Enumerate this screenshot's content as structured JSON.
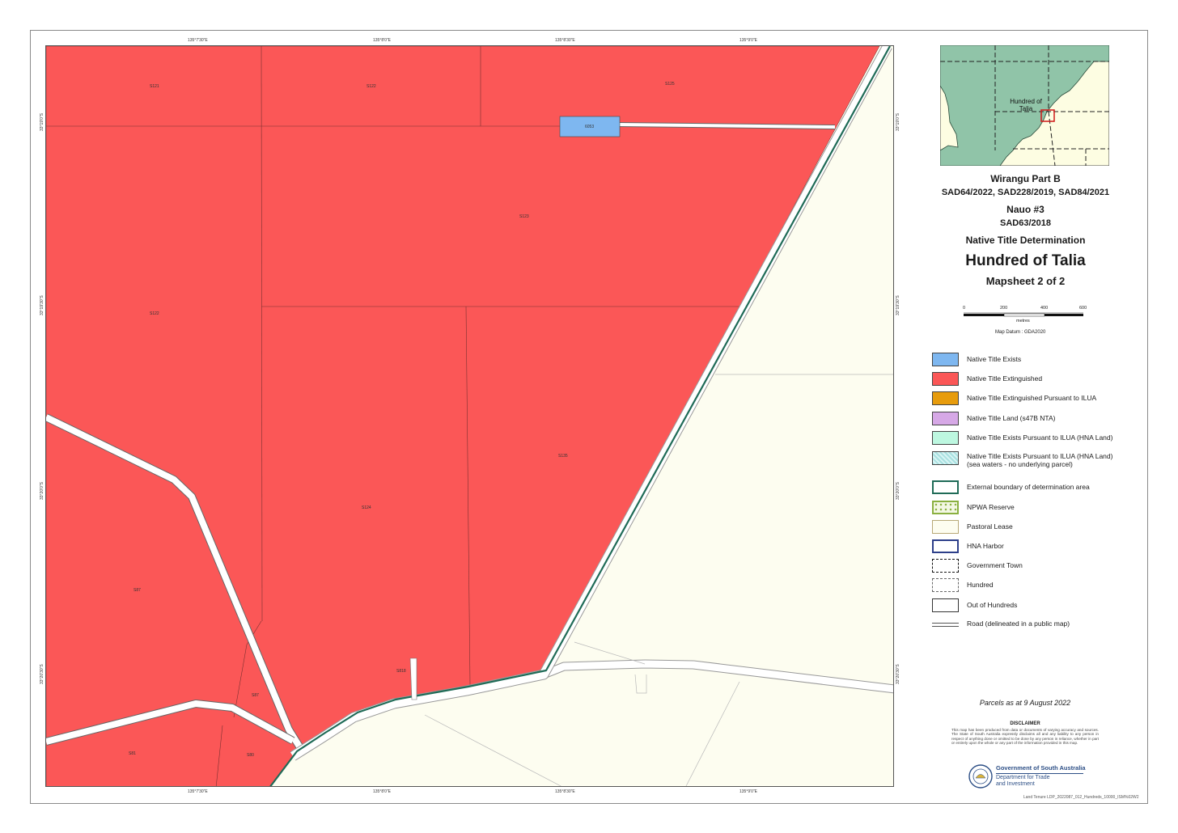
{
  "header": {
    "ticks_top": [
      "135°7'30\"E",
      "135°8'0\"E",
      "135°8'30\"E",
      "135°9'0\"E"
    ],
    "ticks_bottom": [
      "135°7'30\"E",
      "135°8'0\"E",
      "135°8'30\"E",
      "135°9'0\"E"
    ],
    "ticks_left": [
      "33°19'0\"S",
      "33°19'30\"S",
      "33°20'0\"S",
      "33°20'30\"S"
    ],
    "ticks_right": [
      "33°19'0\"S",
      "33°19'30\"S",
      "33°20'0\"S",
      "33°20'30\"S"
    ]
  },
  "map": {
    "parcel_labels": [
      "S121",
      "S122",
      "S125",
      "6053",
      "S123",
      "S122",
      "S135",
      "S124",
      "S87",
      "S818",
      "S87",
      "S81",
      "S80"
    ]
  },
  "locator": {
    "label_line1": "Hundred of",
    "label_line2": "Talia"
  },
  "titles": {
    "line1": "Wirangu Part B",
    "line2": "SAD64/2022, SAD228/2019, SAD84/2021",
    "line3": "Nauo #3",
    "line4": "SAD63/2018",
    "line5": "Native Title Determination",
    "main": "Hundred of Talia",
    "sub": "Mapsheet 2 of 2"
  },
  "scale": {
    "ticks": [
      "0",
      "200",
      "400",
      "600"
    ],
    "unit": "metres",
    "datum": "Map Datum : GDA2020"
  },
  "legend": {
    "items": [
      {
        "label": "Native Title Exists"
      },
      {
        "label": "Native Title Extinguished"
      },
      {
        "label": "Native Title Extinguished Pursuant to ILUA"
      },
      {
        "label": "Native Title Land (s47B NTA)"
      },
      {
        "label": "Native Title Exists Pursuant to ILUA (HNA Land)"
      },
      {
        "label": "Native Title Exists Pursuant to ILUA (HNA Land)",
        "label2": "(sea waters - no underlying parcel)"
      },
      {
        "label": "External boundary of determination area"
      },
      {
        "label": "NPWA Reserve"
      },
      {
        "label": "Pastoral Lease"
      },
      {
        "label": "HNA Harbor"
      },
      {
        "label": "Government Town"
      },
      {
        "label": "Hundred"
      },
      {
        "label": "Out of Hundreds"
      },
      {
        "label": "Road (delineated in a public map)"
      }
    ]
  },
  "footer": {
    "parcels_date": "Parcels as at 9 August 2022",
    "disclaimer_title": "DISCLAIMER",
    "disclaimer_text": "This map has been produced from data or documents of varying accuracy and sources. The State of South Australia expressly disclaims all and any liability to any person in respect of anything done or omitted to be done by any person in reliance, whether in part or entirely upon the whole or any part of the information provided in this map.",
    "gov_name": "Government of South Australia",
    "dept_line1": "Department for Trade",
    "dept_line2": "and Investment",
    "file_ref": "Land Tenure LDP_2022087_012_Hundreds_10000_ISM%02W2"
  },
  "colors": {
    "extinguished": "#fb5757",
    "exists": "#7eb7f0",
    "ilua_extinguished": "#e79c0d",
    "s47b": "#d6a8e6",
    "hna": "#bdf7e0",
    "boundary": "#1f6b57",
    "background": "#fdfdf0",
    "locator_green": "#90c4a8",
    "locator_cream": "#fdfde2"
  }
}
